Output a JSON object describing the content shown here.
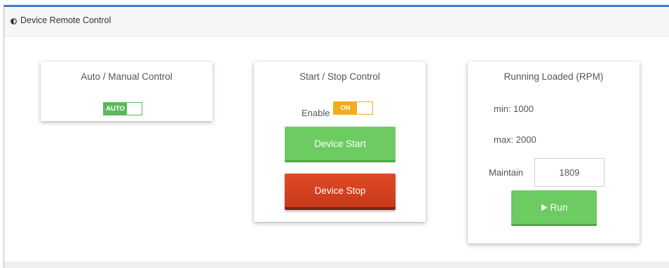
{
  "panel": {
    "title": "Device Remote Control",
    "icon": "half-circle-icon"
  },
  "auto_manual": {
    "title": "Auto / Manual Control",
    "toggle_label": "AUTO",
    "toggle_state": "on",
    "toggle_color": "#5cb85c"
  },
  "start_stop": {
    "title": "Start / Stop Control",
    "enable_label": "Enable",
    "toggle_label": "ON",
    "toggle_state": "on",
    "toggle_color": "#f0ad1e",
    "start_label": "Device Start",
    "start_color": "#6ccc61",
    "stop_label": "Device Stop",
    "stop_color": "#d7401f"
  },
  "rpm": {
    "title": "Running Loaded (RPM)",
    "min_text": "min: 1000",
    "max_text": "max: 2000",
    "maintain_label": "Maintain",
    "maintain_value": "1809",
    "run_label": "Run",
    "run_icon": "play-icon"
  }
}
